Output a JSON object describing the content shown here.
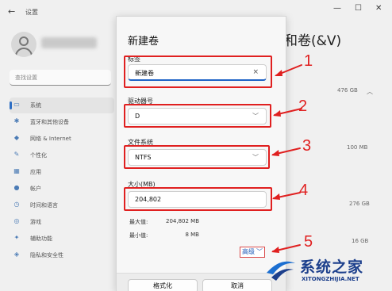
{
  "background": {
    "app_title": "设置",
    "search_placeholder": "查找设置",
    "heading": "盘和卷(&V)",
    "nav_items": [
      {
        "label": "系统",
        "icon": "system-icon",
        "active": true
      },
      {
        "label": "蓝牙和其他设备",
        "icon": "bluetooth-icon",
        "active": false
      },
      {
        "label": "网络 & Internet",
        "icon": "network-icon",
        "active": false
      },
      {
        "label": "个性化",
        "icon": "brush-icon",
        "active": false
      },
      {
        "label": "应用",
        "icon": "apps-icon",
        "active": false
      },
      {
        "label": "帐户",
        "icon": "account-icon",
        "active": false
      },
      {
        "label": "时间和语言",
        "icon": "clock-icon",
        "active": false
      },
      {
        "label": "游戏",
        "icon": "game-icon",
        "active": false
      },
      {
        "label": "辅助功能",
        "icon": "accessibility-icon",
        "active": false
      },
      {
        "label": "隐私和安全性",
        "icon": "shield-icon",
        "active": false
      }
    ],
    "sizes": [
      "476 GB",
      "100 MB",
      "276 GB",
      "16 GB"
    ]
  },
  "dialog": {
    "title": "新建卷",
    "label_field": {
      "label": "标签",
      "value": "新建卷",
      "clear_glyph": "×"
    },
    "drive_letter": {
      "label": "驱动器号",
      "value": "D"
    },
    "file_system": {
      "label": "文件系统",
      "value": "NTFS"
    },
    "size": {
      "label": "大小(MB)",
      "value": "204,802"
    },
    "max_label": "最大值:",
    "max_value": "204,802 MB",
    "min_label": "最小值:",
    "min_value": "8 MB",
    "advanced_label": "高级",
    "format_button": "格式化",
    "cancel_button": "取消"
  },
  "annotations": [
    "1",
    "2",
    "3",
    "4",
    "5"
  ],
  "watermark": {
    "text": "系统之家",
    "url": "XITONGZHIJIA.NET"
  },
  "colors": {
    "annotation_red": "#e02020",
    "accent_blue": "#1f63c6",
    "watermark_blue": "#1c3f8c"
  }
}
